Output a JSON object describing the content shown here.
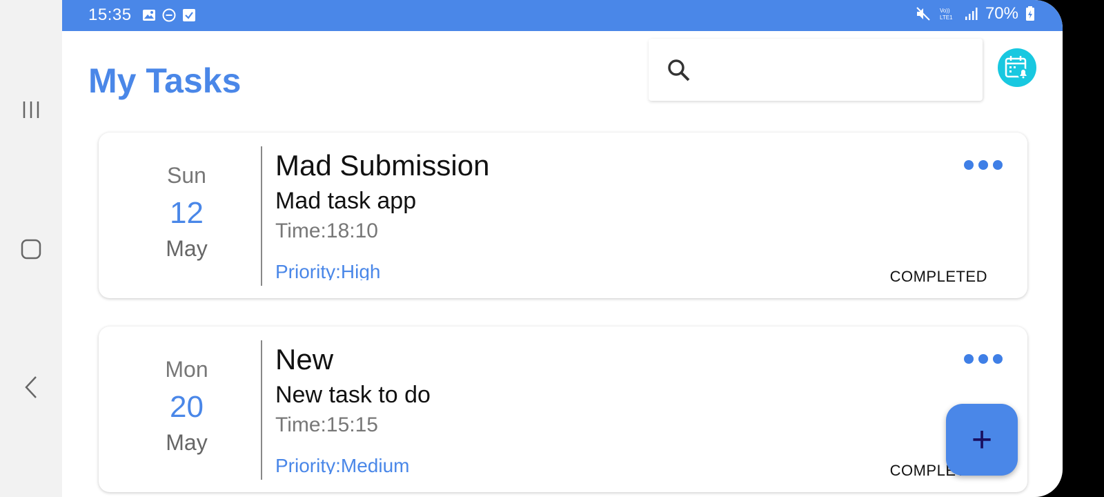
{
  "status_bar": {
    "time": "15:35",
    "left_icons": [
      "image-icon",
      "do-not-disturb-icon",
      "checkbox-icon"
    ],
    "right_icons": [
      "mute-icon",
      "volte-icon",
      "signal-icon",
      "battery-icon"
    ],
    "battery_text": "70%",
    "volte_text": "Vo)) LTE1"
  },
  "app": {
    "title": "My Tasks",
    "search_placeholder": "",
    "search_value": ""
  },
  "colors": {
    "accent": "#4a87e8",
    "calendar_button": "#18c8e0",
    "fab": "#4a87e8"
  },
  "tasks": [
    {
      "day": "Sun",
      "date": "12",
      "month": "May",
      "title": "Mad Submission",
      "description": "Mad task app",
      "time": "Time:18:10",
      "priority": "Priority:High",
      "status": "COMPLETED"
    },
    {
      "day": "Mon",
      "date": "20",
      "month": "May",
      "title": "New",
      "description": "New task to do",
      "time": "Time:15:15",
      "priority": "Priority:Medium",
      "status": "COMPLETED"
    }
  ],
  "fab": {
    "label": "+"
  }
}
